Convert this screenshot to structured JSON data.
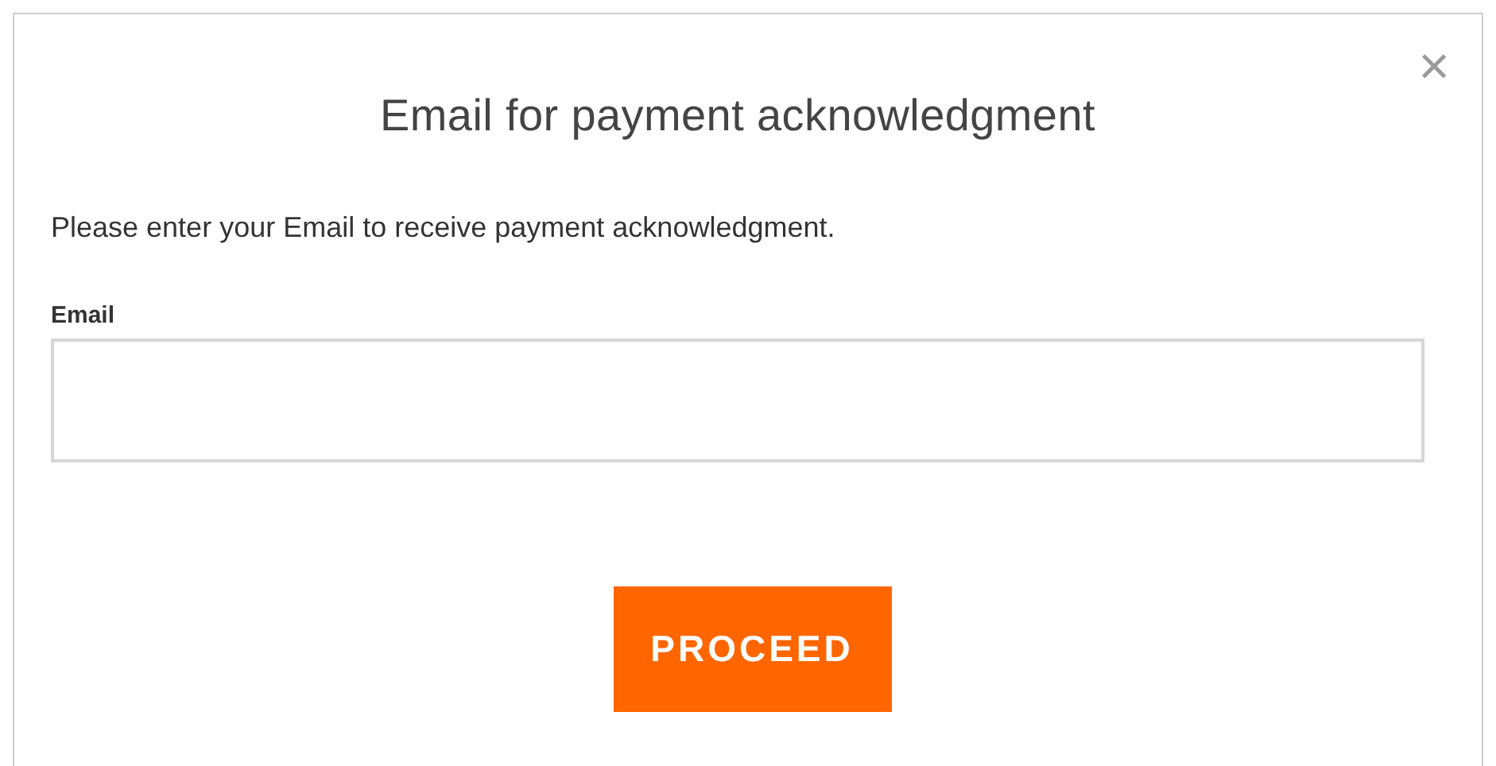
{
  "dialog": {
    "title": "Email for payment acknowledgment",
    "close": "×",
    "message": "Please enter your Email to receive payment acknowledgment.",
    "email_field": {
      "label": "Email"
    },
    "button": "PROCEED"
  }
}
